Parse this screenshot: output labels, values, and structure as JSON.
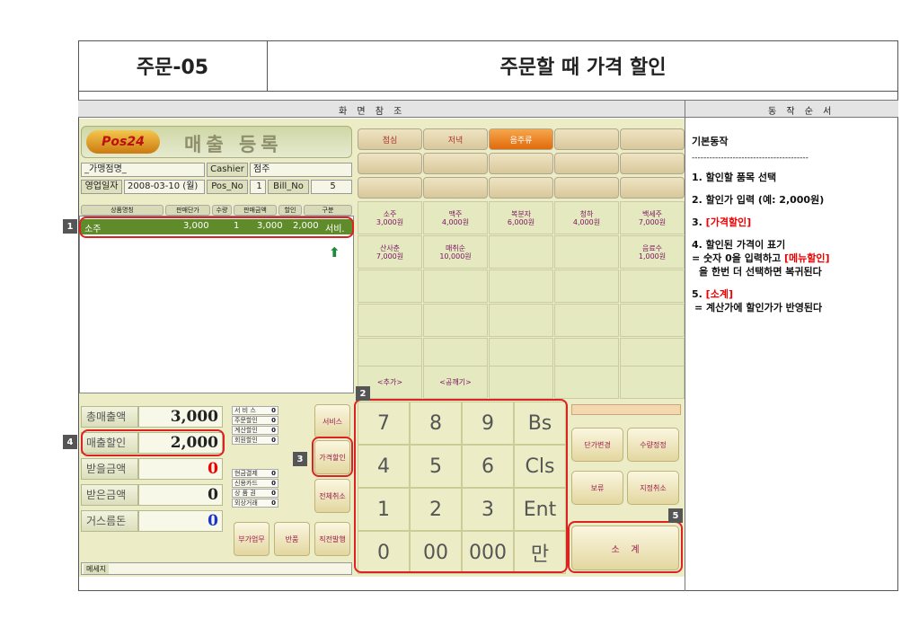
{
  "header": {
    "code": "주문-05",
    "title": "주문할 때 가격 할인"
  },
  "sections": {
    "screen": "화 면 참 조",
    "procedure": "동 작 순 서"
  },
  "app": {
    "logo": "Pos24",
    "title": "매출 등록",
    "store": "_가맹점명_",
    "cashier_label": "Cashier",
    "cashier": "점주",
    "bizdate_label": "영업일자",
    "bizdate": "2008-03-10 (월)",
    "posno_label": "Pos_No",
    "posno": "1",
    "billno_label": "Bill_No",
    "billno": "5",
    "columns": [
      "상품명칭",
      "판매단가",
      "수량",
      "판매금액",
      "할인",
      "구분"
    ],
    "item": {
      "name": "소주",
      "price": "3,000",
      "qty": "1",
      "amount": "3,000",
      "discount": "2,000",
      "type": "서비."
    },
    "tabs": [
      "점심",
      "저녁",
      "음주류"
    ],
    "menus": [
      {
        "name": "소주",
        "price": "3,000원"
      },
      {
        "name": "맥주",
        "price": "4,000원"
      },
      {
        "name": "복분자",
        "price": "6,000원"
      },
      {
        "name": "청하",
        "price": "4,000원"
      },
      {
        "name": "백세주",
        "price": "7,000원"
      },
      {
        "name": "산사춘",
        "price": "7,000원"
      },
      {
        "name": "매취순",
        "price": "10,000원"
      },
      {
        "name": "음료수",
        "price": "1,000원"
      },
      {
        "name": "<추가>"
      },
      {
        "name": "<공깨기>"
      }
    ],
    "summary": [
      {
        "label": "총매출액",
        "value": "3,000"
      },
      {
        "label": "매출할인",
        "value": "2,000"
      },
      {
        "label": "받을금액",
        "value": "0"
      },
      {
        "label": "받은금액",
        "value": "0"
      },
      {
        "label": "거스름돈",
        "value": "0"
      }
    ],
    "mini1": [
      {
        "label": "서 비 스",
        "value": "0"
      },
      {
        "label": "주문할인",
        "value": "0"
      },
      {
        "label": "계산할인",
        "value": "0"
      },
      {
        "label": "회원할인",
        "value": "0"
      }
    ],
    "mini2": [
      {
        "label": "현금결제",
        "value": "0"
      },
      {
        "label": "신용카드",
        "value": "0"
      },
      {
        "label": "상 품 권",
        "value": "0"
      },
      {
        "label": "외상거래",
        "value": "0"
      }
    ],
    "func": {
      "service": "서비스",
      "pricedc": "가격할인",
      "cancelall": "전체취소",
      "vat": "부가업무",
      "refund": "반품",
      "prev": "직전발행"
    },
    "keys": [
      "7",
      "8",
      "9",
      "Bs",
      "4",
      "5",
      "6",
      "Cls",
      "1",
      "2",
      "3",
      "Ent",
      "0",
      "00",
      "000",
      "만"
    ],
    "rbtns": {
      "price_change": "단가변경",
      "qty_change": "수량정정",
      "hold": "보류",
      "cancel_sel": "지정취소",
      "subtotal": "소    계"
    },
    "message_label": "메세지"
  },
  "badges": [
    "1",
    "2",
    "3",
    "4",
    "5"
  ],
  "procedure": {
    "heading": "기본동작",
    "dashes": "----------------------------------------",
    "s1": "1. 할인할 품목 선택",
    "s2": "2. 할인가 입력 (예: 2,000원)",
    "s3n": "3. ",
    "s3": "[가격할인]",
    "s4a": "4. 할인된 가격이 표기",
    "s4b": "= 숫자 0을 입력하고 ",
    "s4c": "[메뉴할인]",
    "s4d": "을 한번 더 선택하면 복귀된다",
    "s5n": "5. ",
    "s5": "[소계]",
    "s5b": "= 계산가에 할인가가 반영된다"
  }
}
